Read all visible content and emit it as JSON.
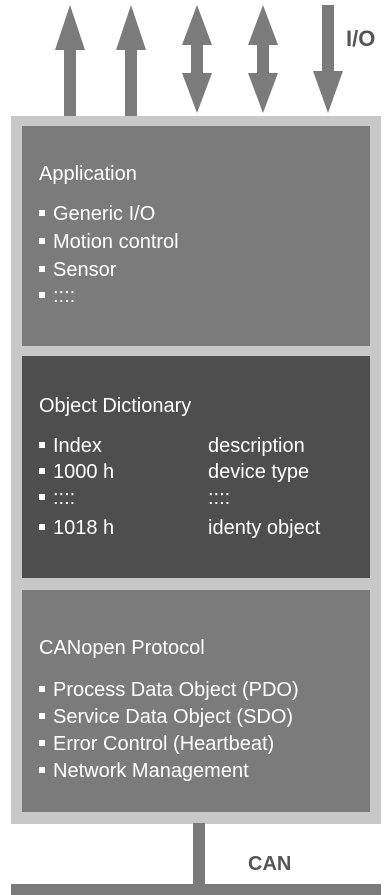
{
  "io_label": "I/O",
  "can_label": "CAN",
  "application": {
    "title": "Application",
    "items": [
      "Generic I/O",
      "Motion control",
      "Sensor",
      "::::"
    ]
  },
  "object_dictionary": {
    "title": "Object Dictionary",
    "rows": [
      [
        "Index",
        "description"
      ],
      [
        "1000 h",
        "device type"
      ],
      [
        "::::",
        "::::"
      ],
      [
        "1018 h",
        "identy object"
      ]
    ]
  },
  "canopen_protocol": {
    "title": "CANopen Protocol",
    "items": [
      "Process Data Object (PDO)",
      "Service Data Object (SDO)",
      "Error Control (Heartbeat)",
      "Network Management"
    ]
  },
  "colors": {
    "frame": "#c8c8c8",
    "layer_light": "#7b7b7b",
    "layer_dark": "#4e4e4e",
    "arrow": "#7b7b7b",
    "label": "#555555"
  }
}
